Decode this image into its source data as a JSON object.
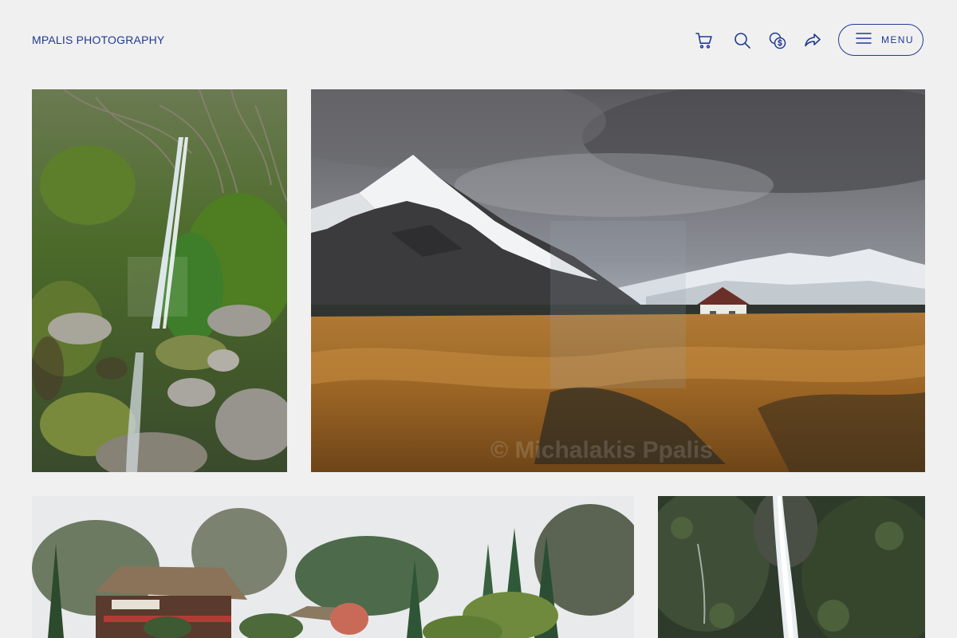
{
  "header": {
    "site_title": "MPALIS PHOTOGRAPHY",
    "menu_label": "MENU",
    "icons": [
      "cart-icon",
      "search-icon",
      "currency-icon",
      "share-icon"
    ]
  },
  "gallery": {
    "watermark_text": "© Michalakis Ppalis"
  },
  "colors": {
    "accent": "#1f3a93",
    "background": "#f0f0f0"
  }
}
